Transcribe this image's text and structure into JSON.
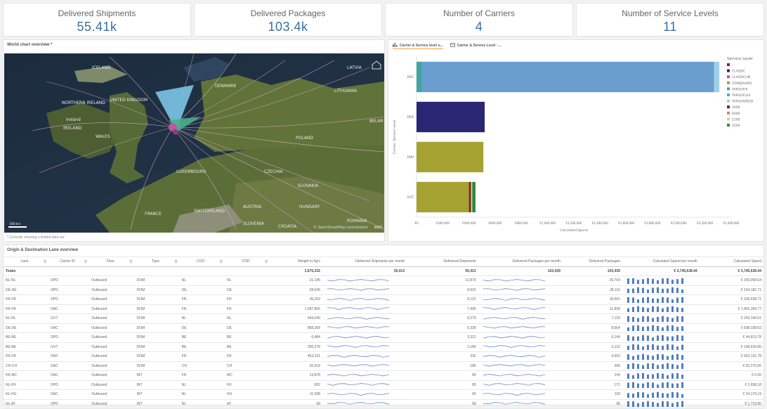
{
  "kpis": [
    {
      "title": "Delivered Shipments",
      "value": "55.41k"
    },
    {
      "title": "Delivered Packages",
      "value": "103.4k"
    },
    {
      "title": "Number of Carriers",
      "value": "4"
    },
    {
      "title": "Number of Service Levels",
      "value": "11"
    }
  ],
  "map": {
    "title": "World chart overview *",
    "footnote": "* Currently showing a limited data set.",
    "attribution": "© OpenStreetMap contributors",
    "esri": "esri",
    "scale": "500 km",
    "labels": [
      {
        "key": "iceland",
        "text": "ICELAND"
      },
      {
        "key": "uk",
        "text": "UNITED KINGDOM"
      },
      {
        "key": "ni",
        "text": "NORTHERN IRELAND"
      },
      {
        "key": "ireland",
        "text": "IRELAND"
      },
      {
        "key": "wales",
        "text": "WALES"
      },
      {
        "key": "ireland2",
        "text": "Ireland"
      },
      {
        "key": "denmark",
        "text": "DENMARK"
      },
      {
        "key": "lithuania",
        "text": "LITHUANIA"
      },
      {
        "key": "latvia",
        "text": "LATVIA"
      },
      {
        "key": "belarus",
        "text": "BELAR"
      },
      {
        "key": "poland",
        "text": "POLAND"
      },
      {
        "key": "luxembourg",
        "text": "LUXEMBOURG"
      },
      {
        "key": "czechia",
        "text": "CZECHIA"
      },
      {
        "key": "slovakia",
        "text": "SLOVAKIA"
      },
      {
        "key": "austria",
        "text": "AUSTRIA"
      },
      {
        "key": "hungary",
        "text": "HUNGARY"
      },
      {
        "key": "switzerland",
        "text": "SWITZERLAND"
      },
      {
        "key": "france",
        "text": "FRANCE"
      },
      {
        "key": "slovenia",
        "text": "SLOVENIA"
      },
      {
        "key": "croatia",
        "text": "CROATIA"
      },
      {
        "key": "romania",
        "text": "ROMANIA"
      }
    ]
  },
  "chart_tabs": [
    "Carrier & Service level o...",
    "Carrier & Service Level - ..."
  ],
  "chart_data": {
    "type": "bar",
    "orientation": "horizontal",
    "stacked": true,
    "categories": [
      "DAC",
      "DPD",
      "DWI",
      "GVT"
    ],
    "xlabel": "Calculated Spend",
    "ylabel": "Carrier, Service Level",
    "xlim": [
      0,
      2400000
    ],
    "x_ticks": [
      "€0",
      "€200,000",
      "€400,000",
      "€600,000",
      "€800,000",
      "€1,000,000",
      "€1,200,000",
      "€1,400,000",
      "€1,600,000",
      "€1,800,000",
      "€2,000,000",
      "€2,200,000",
      "€2,400,000"
    ],
    "legend_title": "Service Level",
    "legend_position": "right",
    "series": [
      {
        "name": "-",
        "color": "#8e1b2f",
        "values": [
          0,
          0,
          0,
          0
        ]
      },
      {
        "name": "CLASSIC",
        "color": "#2a2673",
        "values": [
          0,
          520000,
          0,
          0
        ]
      },
      {
        "name": "CLASSICLIN",
        "color": "#b05aa8",
        "values": [
          0,
          0,
          0,
          0
        ]
      },
      {
        "name": "STANDAARD",
        "color": "#a6a232",
        "values": [
          0,
          0,
          510000,
          400000
        ]
      },
      {
        "name": "TARGOFIX",
        "color": "#3fa6a0",
        "values": [
          40000,
          0,
          0,
          0
        ]
      },
      {
        "name": "TARGOFLEX",
        "color": "#6a9ecf",
        "values": [
          2230000,
          0,
          0,
          0
        ]
      },
      {
        "name": "TARGOSPEED",
        "color": "#9fd0e6",
        "values": [
          40000,
          0,
          0,
          0
        ]
      },
      {
        "name": "1000",
        "color": "#7c1a22",
        "values": [
          0,
          0,
          0,
          15000
        ]
      },
      {
        "name": "6000",
        "color": "#e07d6b",
        "values": [
          0,
          0,
          0,
          0
        ]
      },
      {
        "name": "1200",
        "color": "#e6c888",
        "values": [
          0,
          0,
          0,
          10000
        ]
      },
      {
        "name": "1500",
        "color": "#2e8a3e",
        "values": [
          0,
          0,
          0,
          25000
        ]
      }
    ]
  },
  "table": {
    "title": "Origin & Destination Lane overview",
    "columns": [
      "Lane",
      "Carrier ID",
      "Flow",
      "Type",
      "COO",
      "COD",
      "Weight in Kg's",
      "Delivered Shipments per month",
      "Delivered Shipments",
      "Delivered Packages per month",
      "Delivered Packages",
      "Calculated Spend per month",
      "Calculated Spend"
    ],
    "totals": {
      "label": "Totals",
      "weight": "3,675,332",
      "ship_pm": "55,413",
      "ship": "55,413",
      "pack_pm": "103,439",
      "pack": "103,439",
      "spend_pm": "€ 3,745,638.44",
      "spend": "€ 3,745,638.44"
    },
    "rows": [
      {
        "lane": "NL-NL",
        "carrier": "DPD",
        "flow": "Outbound",
        "type": "DOM",
        "coo": "NL",
        "cod": "NL",
        "weight": "21,145",
        "ship": "12,879",
        "pack": "29,764",
        "spend": "€ 169,058.64"
      },
      {
        "lane": "DE-DE",
        "carrier": "DPD",
        "flow": "Outbound",
        "type": "DOM",
        "coo": "DE",
        "cod": "DE",
        "weight": "28,645",
        "ship": "8,632",
        "pack": "28,116",
        "spend": "€ 154,182.71"
      },
      {
        "lane": "FR-FR",
        "carrier": "DPD",
        "flow": "Outbound",
        "type": "DOM",
        "coo": "FR",
        "cod": "FR",
        "weight": "36,263",
        "ship": "8,122",
        "pack": "18,561",
        "spend": "€ 228,638.71"
      },
      {
        "lane": "FR-FR",
        "carrier": "DAC",
        "flow": "Outbound",
        "type": "DOM",
        "coo": "FR",
        "cod": "FR",
        "weight": "1,387,855",
        "ship": "7,495",
        "pack": "11,858",
        "spend": "€ 1,455,358.77"
      },
      {
        "lane": "NL-NL",
        "carrier": "GVT",
        "flow": "Outbound",
        "type": "DOM",
        "coo": "NL",
        "cod": "NL",
        "weight": "644,649",
        "ship": "6,579",
        "pack": "7,133",
        "spend": "€ 243,149.61"
      },
      {
        "lane": "DE-DE",
        "carrier": "DAC",
        "flow": "Outbound",
        "type": "DOM",
        "coo": "DE",
        "cod": "DE",
        "weight": "858,268",
        "ship": "5,338",
        "pack": "8,664",
        "spend": "€ 698,338.63"
      },
      {
        "lane": "BE-BE",
        "carrier": "DPD",
        "flow": "Outbound",
        "type": "DOM",
        "coo": "BE",
        "cod": "BE",
        "weight": "6,484",
        "ship": "3,321",
        "pack": "6,144",
        "spend": "€ 44,813.78"
      },
      {
        "lane": "BE-BE",
        "carrier": "GVT",
        "flow": "Outbound",
        "type": "DOM",
        "coo": "BE",
        "cod": "BE",
        "weight": "295,278",
        "ship": "2,185",
        "pack": "3,132",
        "spend": "€ 168,918.86"
      },
      {
        "lane": "FR-FR",
        "carrier": "DWI",
        "flow": "Outbound",
        "type": "DOM",
        "coo": "FR",
        "cod": "FR",
        "weight": "463,331",
        "ship": "332",
        "pack": "4,663",
        "spend": "€ 563,131.78"
      },
      {
        "lane": "CH-CH",
        "carrier": "DAC",
        "flow": "Outbound",
        "type": "DOM",
        "coo": "CH",
        "cod": "CH",
        "weight": "26,918",
        "ship": "186",
        "pack": "268",
        "spend": "€ 62,275.65"
      },
      {
        "lane": "FR-MC",
        "carrier": "DAC",
        "flow": "Outbound",
        "type": "INT",
        "coo": "FR",
        "cod": "MC",
        "weight": "13,878",
        "ship": "84",
        "pack": "144",
        "spend": "€ 0.00"
      },
      {
        "lane": "NL-FR",
        "carrier": "DPD",
        "flow": "Outbound",
        "type": "INT",
        "coo": "NL",
        "cod": "FR",
        "weight": "892",
        "ship": "89",
        "pack": "171",
        "spend": "€ 2,658.18"
      },
      {
        "lane": "NL-HU",
        "carrier": "DAC",
        "flow": "Outbound",
        "type": "INT",
        "coo": "NL",
        "cod": "HU",
        "weight": "11,588",
        "ship": "66",
        "pack": "118",
        "spend": "€ 24,179.19"
      },
      {
        "lane": "NL-AT",
        "carrier": "DPD",
        "flow": "Outbound",
        "type": "INT",
        "coo": "NL",
        "cod": "AT",
        "weight": "99",
        "ship": "58",
        "pack": "98",
        "spend": "€ 1,719.80"
      }
    ]
  }
}
